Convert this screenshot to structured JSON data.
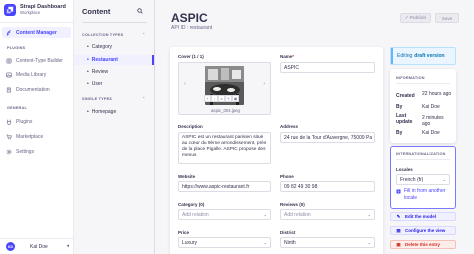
{
  "app": {
    "name": "Strapi Dashboard",
    "workspace": "Workplace"
  },
  "mainnav": {
    "items": [
      {
        "label": "Content Manager"
      },
      {
        "label": "Content-Type Builder"
      },
      {
        "label": "Media Library"
      },
      {
        "label": "Documentation"
      },
      {
        "label": "Plugins"
      },
      {
        "label": "Marketplace"
      },
      {
        "label": "Settings"
      }
    ],
    "sections": {
      "plugins": "PLUGINS",
      "general": "GENERAL"
    },
    "user": {
      "initials": "KD",
      "name": "Kai Doe"
    }
  },
  "subnav": {
    "title": "Content",
    "sections": {
      "collection": "COLLECTION TYPES",
      "single": "SINGLE TYPES"
    },
    "collection_items": [
      "Category",
      "Restaurant",
      "Review",
      "User"
    ],
    "single_items": [
      "Homepage"
    ]
  },
  "header": {
    "back": "← Back",
    "title": "ASPIC",
    "subtitle": "API ID : restaurant",
    "publish": "✓ Publish",
    "save": "Save"
  },
  "form": {
    "cover": {
      "label": "Cover (1 / 1)",
      "filename": "aspic_004.jpeg"
    },
    "name": {
      "label": "Name",
      "value": "ASPIC"
    },
    "description": {
      "label": "Description",
      "value": "ASPIC est un restaurant parisien situé au cœur du 9ème arrondissement, près de la place Pigalle. ASPIC propose des menus"
    },
    "address": {
      "label": "Address",
      "value": "24 rue de la Tour d'Auvergne, 75009 Pa"
    },
    "website": {
      "label": "Website",
      "value": "https://www.aspic-restaurant.fr"
    },
    "phone": {
      "label": "Phone",
      "value": "09 82 49 30 98"
    },
    "category": {
      "label": "Category (0)",
      "placeholder": "Add relation"
    },
    "reviews": {
      "label": "Reviews (0)",
      "placeholder": "Add relation"
    },
    "price": {
      "label": "Price",
      "value": "Luxury"
    },
    "district": {
      "label": "District",
      "value": "Ninth"
    }
  },
  "panel": {
    "editing_prefix": "Editing",
    "editing_status": "draft version",
    "info_title": "INFORMATION",
    "info": [
      {
        "key": "Created",
        "value": "22 hours ago"
      },
      {
        "key": "By",
        "value": "Kai Doe"
      },
      {
        "key": "Last update",
        "value": "2 minutes ago"
      },
      {
        "key": "By",
        "value": "Kai Doe"
      }
    ],
    "i18n_title": "INTERNATIONALIZATION",
    "locales_label": "Locales",
    "locale_value": "French (fr)",
    "fill_link": "Fill in from another locale",
    "edit_model": "Edit the model",
    "configure_view": "Configure the view",
    "delete_entry": "Delete this entry"
  },
  "colors": {
    "primary": "#4945ff",
    "danger": "#d02b20",
    "info": "#0c75af"
  }
}
